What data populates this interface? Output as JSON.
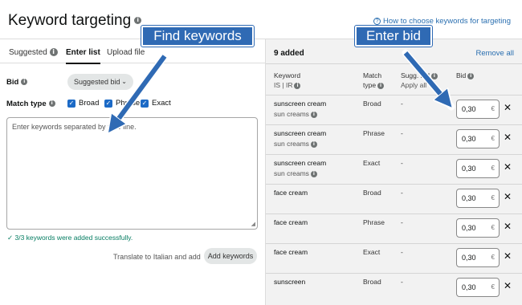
{
  "header": {
    "title": "Keyword targeting",
    "help_link": "How to choose keywords for targeting"
  },
  "left": {
    "tabs": [
      {
        "label": "Suggested",
        "active": false
      },
      {
        "label": "Enter list",
        "active": true
      },
      {
        "label": "Upload file",
        "active": false
      }
    ],
    "bid_label": "Bid",
    "bid_dropdown": "Suggested bid",
    "match_type_label": "Match type",
    "match_types": [
      "Broad",
      "Phrase",
      "Exact"
    ],
    "textarea_placeholder": "Enter keywords separated by new line.",
    "success_message": "3/3 keywords were added successfully.",
    "translate_label": "Translate to Italian and add",
    "add_keywords_label": "Add keywords"
  },
  "right": {
    "added_count": "9 added",
    "remove_all": "Remove all",
    "columns": {
      "keyword": "Keyword",
      "keyword_sub": "IS | IR",
      "match": "Match",
      "match_sub": "type",
      "sugg": "Sugg. bid",
      "sugg_sub": "Apply all",
      "bid": "Bid"
    },
    "rows": [
      {
        "keyword": "sunscreen cream",
        "sub": "sun creams",
        "match": "Broad",
        "sugg": "-",
        "bid": "0,30",
        "currency": "€"
      },
      {
        "keyword": "sunscreen cream",
        "sub": "sun creams",
        "match": "Phrase",
        "sugg": "-",
        "bid": "0,30",
        "currency": "€"
      },
      {
        "keyword": "sunscreen cream",
        "sub": "sun creams",
        "match": "Exact",
        "sugg": "-",
        "bid": "0,30",
        "currency": "€"
      },
      {
        "keyword": "face cream",
        "sub": "",
        "match": "Broad",
        "sugg": "-",
        "bid": "0,30",
        "currency": "€"
      },
      {
        "keyword": "face cream",
        "sub": "",
        "match": "Phrase",
        "sugg": "-",
        "bid": "0,30",
        "currency": "€"
      },
      {
        "keyword": "face cream",
        "sub": "",
        "match": "Exact",
        "sugg": "-",
        "bid": "0,30",
        "currency": "€"
      },
      {
        "keyword": "sunscreen",
        "sub": "",
        "match": "Broad",
        "sugg": "-",
        "bid": "0,30",
        "currency": "€"
      }
    ]
  },
  "annotations": {
    "find_keywords": "Find keywords",
    "enter_bid": "Enter bid"
  },
  "colors": {
    "accent": "#1c6ac6",
    "link": "#2a6fb0",
    "callout": "#2f6ab4",
    "success": "#067d62"
  }
}
